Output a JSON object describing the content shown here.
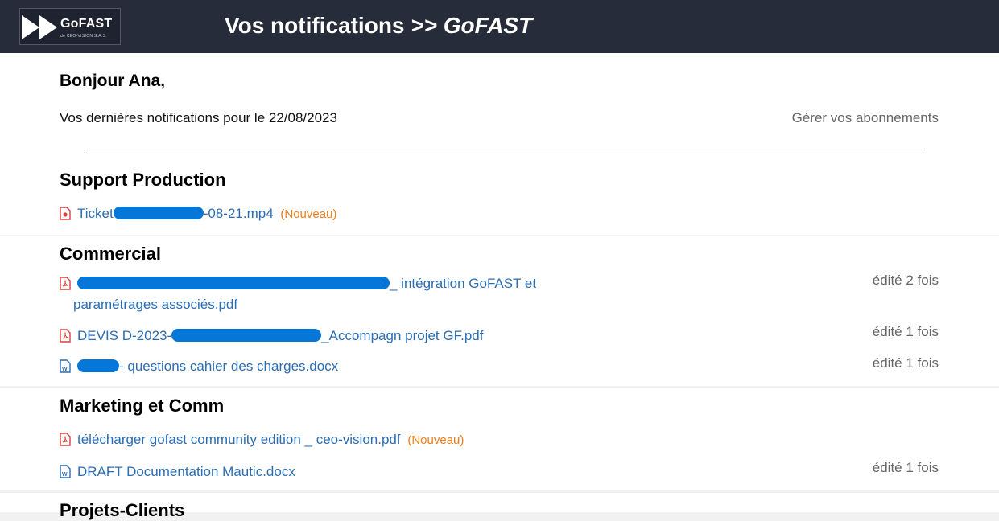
{
  "header": {
    "logo_text": "GoFAST",
    "logo_subtext": "de CEO-VISION S.A.S.",
    "title": "Vos notifications",
    "title_sep": ">>",
    "title_brand": "GoFAST"
  },
  "greeting": "Bonjour Ana,",
  "subtitle": "Vos dernières notifications pour le 22/08/2023",
  "manage_link": "Gérer vos abonnements",
  "sections": [
    {
      "title": "Support Production",
      "files": [
        {
          "icon": "video-file-icon",
          "prefix": "Ticket",
          "suffix": "-08-21.mp4",
          "badge": "(Nouveau)"
        }
      ]
    },
    {
      "title": "Commercial",
      "files": [
        {
          "icon": "pdf-file-icon",
          "prefix": "",
          "suffix": "_ intégration GoFAST et",
          "suffix2": "paramétrages associés.pdf",
          "edited": "édité 2 fois"
        },
        {
          "icon": "pdf-file-icon",
          "prefix": "DEVIS D-2023-",
          "suffix": "_Accompagn projet GF.pdf",
          "edited": "édité 1 fois"
        },
        {
          "icon": "word-file-icon",
          "prefix": "",
          "suffix": "- questions cahier des charges.docx",
          "edited": "édité 1 fois"
        }
      ]
    },
    {
      "title": "Marketing et Comm",
      "files": [
        {
          "icon": "pdf-file-icon",
          "prefix": "",
          "suffix": "télécharger gofast community edition _ ceo-vision.pdf",
          "badge": "(Nouveau)"
        },
        {
          "icon": "word-file-icon",
          "prefix": "",
          "suffix": "DRAFT Documentation Mautic.docx",
          "edited": "édité 1 fois"
        }
      ]
    },
    {
      "title": "Projets-Clients"
    }
  ],
  "colors": {
    "header_bg": "#272c3a",
    "link": "#2a6db3",
    "badge_new": "#f07d19",
    "redaction": "#0677d8"
  }
}
